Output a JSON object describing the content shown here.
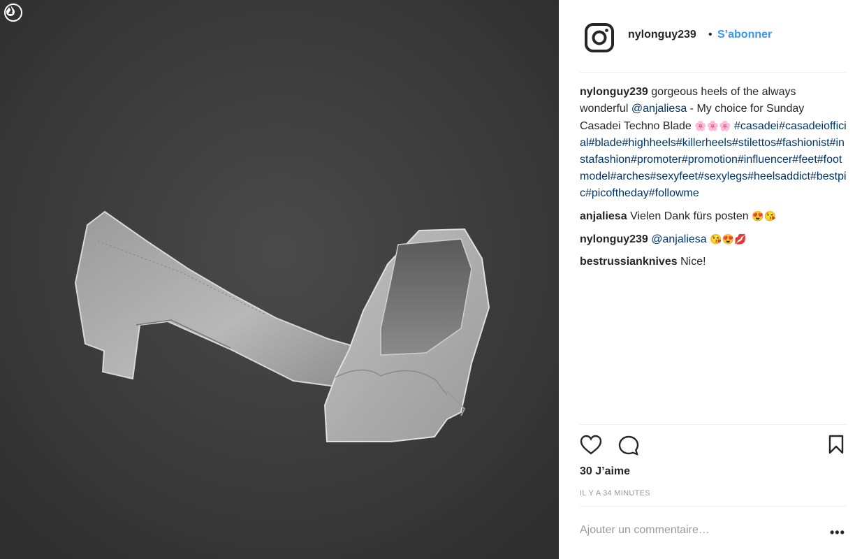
{
  "post": {
    "username": "nylonguy239",
    "separator": "•",
    "follow_label": "S’abonner",
    "caption": {
      "text_1": "gorgeous heels of the always wonderful ",
      "mention": "@anjaliesa",
      "text_2": " - My choice for Sunday Casadei Techno Blade ",
      "emoji": "🌸🌸🌸",
      "hashtags": "#casadei#casadeiofficial#blade#highheels#killerheels#stilettos#fashionist#instafashion#promoter#promotion#influencer#feet#footmodel#arches#sexyfeet#sexylegs#heelsaddict#bestpic#picoftheday#followme"
    },
    "comments": [
      {
        "username": "anjaliesa",
        "text": "Vielen Dank fürs posten ",
        "emoji": "😍😘"
      },
      {
        "username": "nylonguy239",
        "mention": "@anjaliesa",
        "text": " ",
        "emoji": "😘😍💋"
      },
      {
        "username": "bestrussianknives",
        "text": "Nice!"
      }
    ],
    "likes_label": "30 J’aime",
    "timestamp": "IL Y A 34 MINUTES",
    "add_comment_placeholder": "Ajouter un commentaire…",
    "more_label": "•••"
  },
  "icons": {
    "corner": "flame-logo-icon",
    "brand": "instagram-logo-icon",
    "like": "heart-icon",
    "comment": "comment-bubble-icon",
    "save": "bookmark-icon"
  },
  "colors": {
    "link_blue": "#3897f0",
    "hashtag_blue": "#003569",
    "text": "#262626",
    "muted": "#999999"
  }
}
